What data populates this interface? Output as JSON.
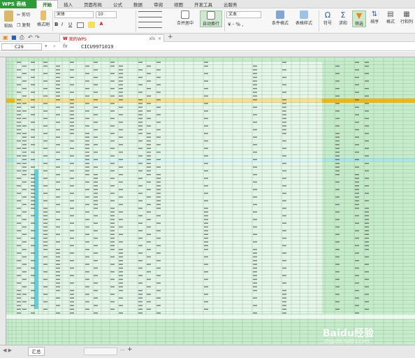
{
  "app": {
    "title": "WPS 表格"
  },
  "menu": {
    "tabs": [
      "开始",
      "插入",
      "页面布局",
      "公式",
      "数据",
      "审阅",
      "视图",
      "开发工具",
      "云服务"
    ]
  },
  "ribbon": {
    "paste": "粘贴",
    "cut": "剪切",
    "copy": "复制",
    "format_painter": "格式刷",
    "font_name": "宋体",
    "font_size": "10",
    "merge_center": "合并居中",
    "wrap_text": "自动换行",
    "number_format": "文本",
    "conditional_format": "条件格式",
    "table_style": "表格样式",
    "symbol": "符号",
    "sum": "求和",
    "filter": "筛选",
    "sort": "排序",
    "format": "格式",
    "row_col": "行和列"
  },
  "doc_tab": {
    "label": "我的WPS",
    "file_suffix": "xls"
  },
  "formula_bar": {
    "cell_ref": "C29",
    "fx": "fx",
    "value": "CICU9971019"
  },
  "sheet_tabs": {
    "active": "汇总",
    "add": "+"
  },
  "watermark": {
    "brand": "Baidu经验",
    "url": "jingyan.baidu.com"
  },
  "colors": {
    "grid_bg": "#c7eccc",
    "highlight_row": "#f5b800",
    "cyan_row": "#a8e6ea",
    "accent": "#2e9a3a"
  }
}
